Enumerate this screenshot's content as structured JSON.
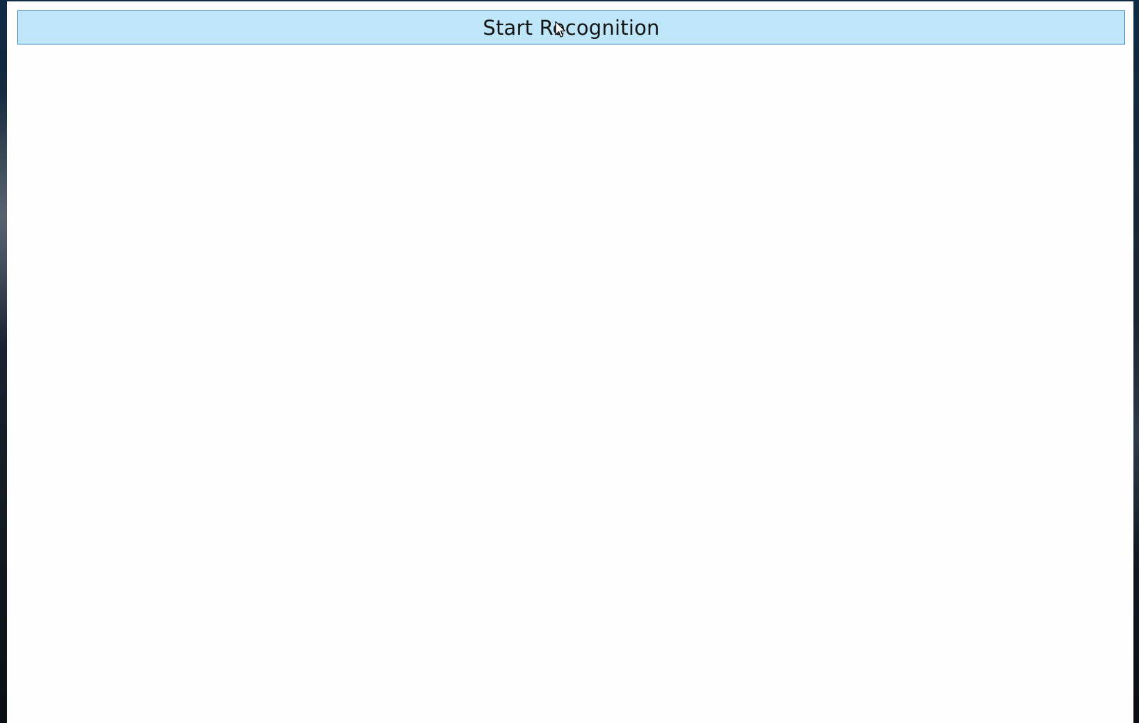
{
  "window": {
    "background_color": "#fdfdfd"
  },
  "toolbar": {
    "start_label": "Start Recognition",
    "button_color": "#bee6f8",
    "button_border_color": "#3c7fb1"
  },
  "cursor": {
    "icon": "arrow-cursor-icon"
  }
}
